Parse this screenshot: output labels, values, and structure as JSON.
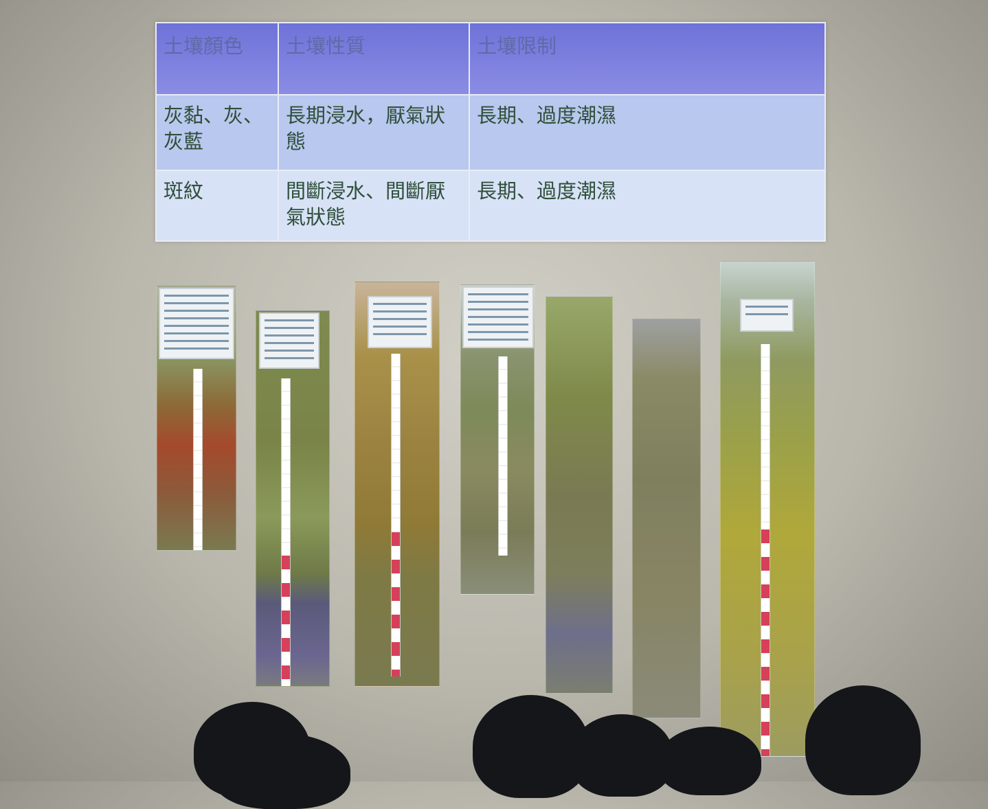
{
  "soil_table": {
    "headers": [
      "土壤顏色",
      "土壤性質",
      "土壤限制"
    ],
    "rows": [
      [
        "灰黏、灰、灰藍",
        "長期浸水，厭氣狀態",
        "長期、過度潮濕"
      ],
      [
        "斑紋",
        "間斷浸水、間斷厭氣狀態",
        "長期、過度潮濕"
      ]
    ]
  },
  "photos": [
    {
      "label": "soil-profile-1"
    },
    {
      "label": "soil-profile-2"
    },
    {
      "label": "soil-profile-3"
    },
    {
      "label": "soil-profile-4"
    },
    {
      "label": "soil-profile-5"
    },
    {
      "label": "soil-profile-6"
    },
    {
      "label": "soil-profile-7"
    }
  ],
  "colors": {
    "header_bg": "#7a7de0",
    "row1_bg": "#b9c8ee",
    "row2_bg": "#d8e2f6",
    "text": "#2f4f3a"
  }
}
